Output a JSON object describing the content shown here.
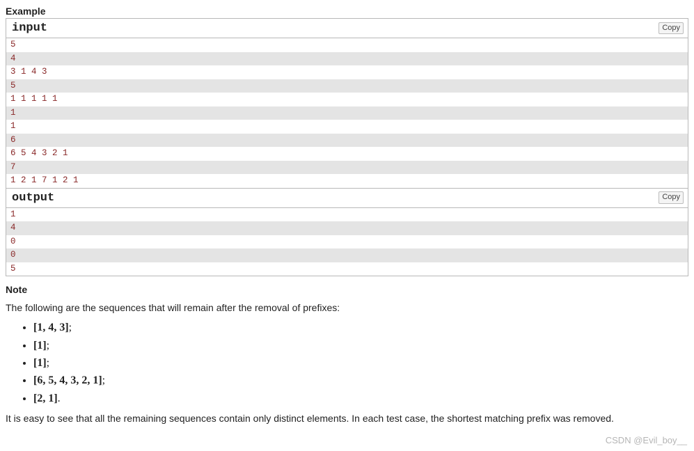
{
  "example_heading": "Example",
  "input_label": "input",
  "output_label": "output",
  "copy_label": "Copy",
  "input_lines": [
    "5",
    "4",
    "3 1 4 3",
    "5",
    "1 1 1 1 1",
    "1",
    "1",
    "6",
    "6 5 4 3 2 1",
    "7",
    "1 2 1 7 1 2 1"
  ],
  "output_lines": [
    "1",
    "4",
    "0",
    "0",
    "5"
  ],
  "note_heading": "Note",
  "note_intro": "The following are the sequences that will remain after the removal of prefixes:",
  "note_sequences": [
    "[1, 4, 3]",
    "[1]",
    "[1]",
    "[6, 5, 4, 3, 2, 1]",
    "[2, 1]"
  ],
  "note_seq_terminators": [
    ";",
    ";",
    ";",
    ";",
    "."
  ],
  "note_conclusion": "It is easy to see that all the remaining sequences contain only distinct elements. In each test case, the shortest matching prefix was removed.",
  "watermark": "CSDN @Evil_boy__"
}
